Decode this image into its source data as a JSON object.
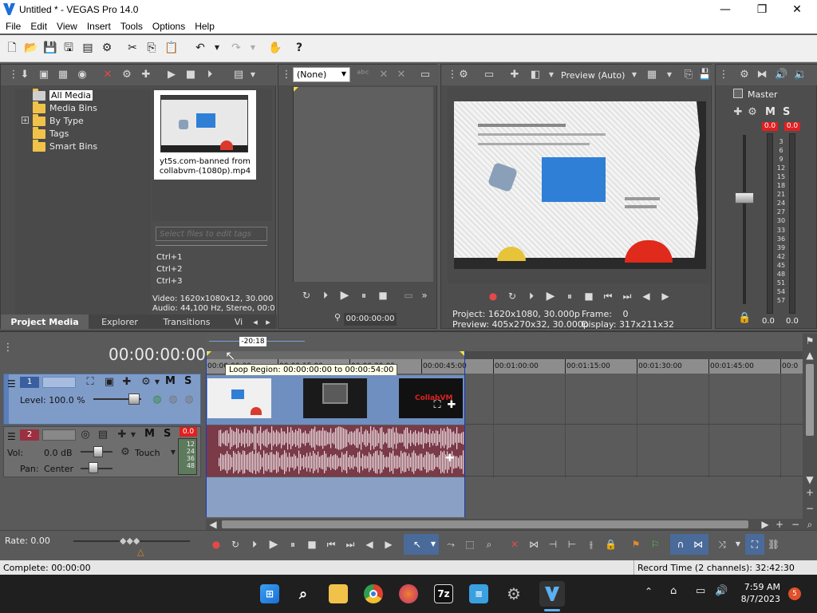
{
  "window": {
    "title": "Untitled * - VEGAS Pro 14.0",
    "minimize": "—",
    "maximize": "❐",
    "close": "✕"
  },
  "menu": [
    "File",
    "Edit",
    "View",
    "Insert",
    "Tools",
    "Options",
    "Help"
  ],
  "explorer": {
    "items": [
      "All Media",
      "Media Bins",
      "By Type",
      "Tags",
      "Smart Bins"
    ],
    "expander": "+",
    "media_file": "yt5s.com-banned from collabvm-(1080p).mp4",
    "tags_placeholder": "Select files to edit tags",
    "shortcuts": [
      "Ctrl+1",
      "Ctrl+2",
      "Ctrl+3"
    ],
    "video_info": "Video: 1620x1080x12, 30.000",
    "audio_info": "Audio: 44,100 Hz, Stereo, 00:0",
    "tabs": [
      "Project Media",
      "Explorer",
      "Transitions",
      "Vi"
    ]
  },
  "trimmer": {
    "dropdown_value": "(None)",
    "timecode": "00:00:00:00"
  },
  "preview": {
    "mode": "Preview (Auto)",
    "project_label": "Project:",
    "project_value": "1620x1080, 30.000p",
    "preview_label": "Preview:",
    "preview_value": "405x270x32, 30.000p",
    "frame_label": "Frame:",
    "frame_value": "0",
    "display_label": "Display:",
    "display_value": "317x211x32"
  },
  "master": {
    "label": "Master",
    "left_peak": "0.0",
    "right_peak": "0.0",
    "left_val": "0.0",
    "right_val": "0.0",
    "scale": [
      "3",
      "6",
      "9",
      "12",
      "15",
      "18",
      "21",
      "24",
      "27",
      "30",
      "33",
      "36",
      "39",
      "42",
      "45",
      "48",
      "51",
      "54",
      "57"
    ],
    "mute": "M",
    "solo": "S"
  },
  "timeline": {
    "timecode": "00:00:00:00",
    "loop_length": "-20:18",
    "loop_tooltip": "Loop Region: 00:00:00:00 to 00:00:54:00",
    "ruler": [
      "00:00:00:00",
      "00:00:15:00",
      "00:00:30:00",
      "00:00:45:00",
      "00:01:00:00",
      "00:01:15:00",
      "00:01:30:00",
      "00:01:45:00",
      "00:0"
    ],
    "track1": {
      "number": "1",
      "level_label": "Level: 100.0 %",
      "mute": "M",
      "solo": "S"
    },
    "track2": {
      "number": "2",
      "vol_label": "Vol:",
      "vol_value": "0.0 dB",
      "pan_label": "Pan:",
      "pan_value": "Center",
      "automation": "Touch",
      "mute": "M",
      "solo": "S",
      "peak": "0.0",
      "meter_scale": [
        "12",
        "24",
        "36",
        "48"
      ]
    },
    "clip_logo_text": "CollabVM"
  },
  "transport": {
    "rate_label": "Rate: 0.00"
  },
  "status": {
    "complete": "Complete: 00:00:00",
    "record_time": "Record Time (2 channels): 32:42:30"
  },
  "taskbar": {
    "time": "7:59 AM",
    "date": "8/7/2023",
    "notifications": "5",
    "apps": [
      "start",
      "search",
      "file-explorer",
      "chrome",
      "firefox",
      "7z",
      "notepad",
      "settings",
      "vegas"
    ],
    "sevenzip_label": "7z"
  }
}
